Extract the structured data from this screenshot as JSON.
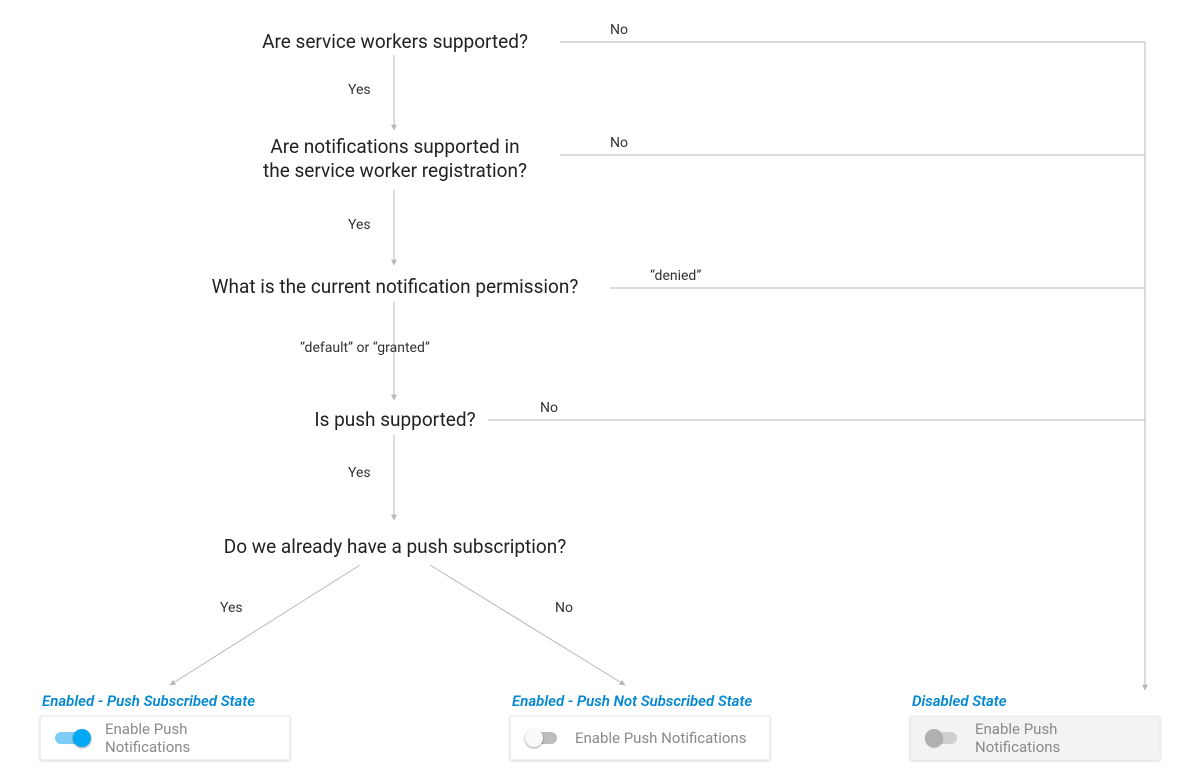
{
  "questions": {
    "q1": "Are service workers supported?",
    "q2a": "Are notifications supported in",
    "q2b": "the service worker registration?",
    "q3": "What is the current notification permission?",
    "q4": "Is push supported?",
    "q5": "Do we already have a push subscription?"
  },
  "labels": {
    "yes": "Yes",
    "no": "No",
    "denied": "“denied”",
    "default_or_granted": "“default” or “granted”"
  },
  "states": {
    "subscribed": {
      "title": "Enabled - Push Subscribed State",
      "card": "Enable Push Notifications"
    },
    "not_subscribed": {
      "title": "Enabled - Push Not Subscribed State",
      "card": "Enable Push Notifications"
    },
    "disabled": {
      "title": "Disabled State",
      "card": "Enable Push Notifications"
    }
  },
  "chart_data": {
    "type": "flowchart",
    "nodes": [
      {
        "id": "q1",
        "type": "decision",
        "text": "Are service workers supported?"
      },
      {
        "id": "q2",
        "type": "decision",
        "text": "Are notifications supported in the service worker registration?"
      },
      {
        "id": "q3",
        "type": "decision",
        "text": "What is the current notification permission?"
      },
      {
        "id": "q4",
        "type": "decision",
        "text": "Is push supported?"
      },
      {
        "id": "q5",
        "type": "decision",
        "text": "Do we already have a push subscription?"
      },
      {
        "id": "s_sub",
        "type": "terminal",
        "text": "Enabled - Push Subscribed State",
        "toggle": "on"
      },
      {
        "id": "s_not",
        "type": "terminal",
        "text": "Enabled - Push Not Subscribed State",
        "toggle": "off"
      },
      {
        "id": "s_dis",
        "type": "terminal",
        "text": "Disabled State",
        "toggle": "disabled"
      }
    ],
    "edges": [
      {
        "from": "q1",
        "to": "q2",
        "label": "Yes"
      },
      {
        "from": "q1",
        "to": "s_dis",
        "label": "No"
      },
      {
        "from": "q2",
        "to": "q3",
        "label": "Yes"
      },
      {
        "from": "q2",
        "to": "s_dis",
        "label": "No"
      },
      {
        "from": "q3",
        "to": "q4",
        "label": "“default” or “granted”"
      },
      {
        "from": "q3",
        "to": "s_dis",
        "label": "“denied”"
      },
      {
        "from": "q4",
        "to": "q5",
        "label": "Yes"
      },
      {
        "from": "q4",
        "to": "s_dis",
        "label": "No"
      },
      {
        "from": "q5",
        "to": "s_sub",
        "label": "Yes"
      },
      {
        "from": "q5",
        "to": "s_not",
        "label": "No"
      }
    ]
  }
}
